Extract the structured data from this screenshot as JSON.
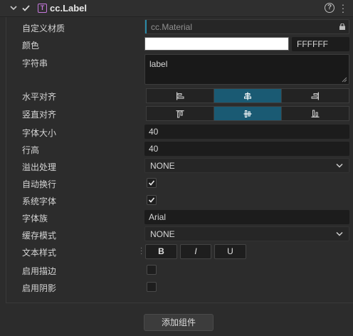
{
  "component": {
    "title": "cc.Label",
    "icon": "label-component-icon",
    "enabled": true,
    "accent": "#c678dd"
  },
  "props": {
    "custom_material": {
      "label": "自定义材质",
      "value": "cc.Material"
    },
    "color": {
      "label": "颜色",
      "hex": "FFFFFF",
      "swatch": "#ffffff"
    },
    "string": {
      "label": "字符串",
      "value": "label"
    },
    "h_align": {
      "label": "水平对齐",
      "options": [
        "left",
        "center",
        "right"
      ],
      "selected": "center"
    },
    "v_align": {
      "label": "竖直对齐",
      "options": [
        "top",
        "center",
        "bottom"
      ],
      "selected": "center"
    },
    "font_size": {
      "label": "字体大小",
      "value": "40"
    },
    "line_height": {
      "label": "行高",
      "value": "40"
    },
    "overflow": {
      "label": "溢出处理",
      "value": "NONE"
    },
    "wrap": {
      "label": "自动换行",
      "checked": true
    },
    "system_font": {
      "label": "系统字体",
      "checked": true
    },
    "font_family": {
      "label": "字体族",
      "value": "Arial"
    },
    "cache_mode": {
      "label": "缓存模式",
      "value": "NONE"
    },
    "text_style": {
      "label": "文本样式",
      "bold": "B",
      "italic": "I",
      "underline": "U"
    },
    "outline": {
      "label": "启用描边",
      "checked": false
    },
    "shadow": {
      "label": "启用阴影",
      "checked": false
    }
  },
  "footer": {
    "add_component": "添加组件"
  },
  "colors": {
    "active_segment": "#1a5a73",
    "material_accent": "#2a8aa8"
  }
}
